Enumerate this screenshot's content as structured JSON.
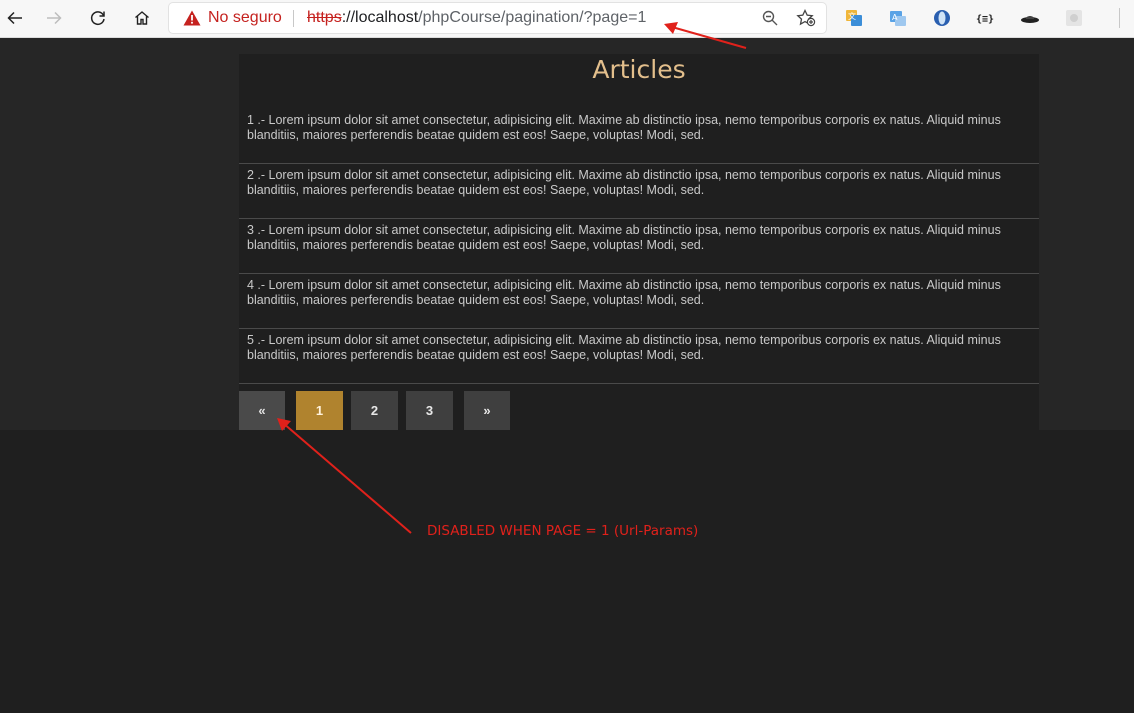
{
  "browser": {
    "security_label": "No seguro",
    "url_scheme": "https",
    "url_host": "://localhost",
    "url_path": "/phpCourse/pagination/?page=1",
    "extensions": [
      "translate-extension-icon",
      "translate-extension-icon",
      "browser-extension-icon",
      "json-extension-icon",
      "ufo-extension-icon",
      "puzzle-extension-icon"
    ]
  },
  "page": {
    "title": "Articles",
    "articles": [
      "1 .- Lorem ipsum dolor sit amet consectetur, adipisicing elit. Maxime ab distinctio ipsa, nemo temporibus corporis ex natus. Aliquid minus blanditiis, maiores perferendis beatae quidem est eos! Saepe, voluptas! Modi, sed.",
      "2 .- Lorem ipsum dolor sit amet consectetur, adipisicing elit. Maxime ab distinctio ipsa, nemo temporibus corporis ex natus. Aliquid minus blanditiis, maiores perferendis beatae quidem est eos! Saepe, voluptas! Modi, sed.",
      "3 .- Lorem ipsum dolor sit amet consectetur, adipisicing elit. Maxime ab distinctio ipsa, nemo temporibus corporis ex natus. Aliquid minus blanditiis, maiores perferendis beatae quidem est eos! Saepe, voluptas! Modi, sed.",
      "4 .- Lorem ipsum dolor sit amet consectetur, adipisicing elit. Maxime ab distinctio ipsa, nemo temporibus corporis ex natus. Aliquid minus blanditiis, maiores perferendis beatae quidem est eos! Saepe, voluptas! Modi, sed.",
      "5 .- Lorem ipsum dolor sit amet consectetur, adipisicing elit. Maxime ab distinctio ipsa, nemo temporibus corporis ex natus. Aliquid minus blanditiis, maiores perferendis beatae quidem est eos! Saepe, voluptas! Modi, sed."
    ],
    "pagination": {
      "prev": "«",
      "pages": [
        "1",
        "2",
        "3"
      ],
      "next": "»",
      "current": "1"
    }
  },
  "annotation": {
    "text": "DISABLED WHEN PAGE = 1 (Url-Params)",
    "color": "#e0211b"
  },
  "colors": {
    "title": "#e3bf8c",
    "active_page": "#b0832e",
    "background": "#1f1f1f"
  }
}
